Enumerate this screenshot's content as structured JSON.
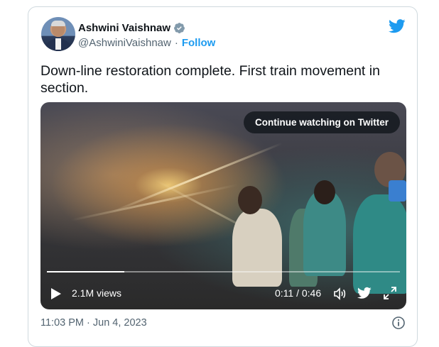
{
  "author": {
    "display_name": "Ashwini Vaishnaw",
    "handle": "@AshwiniVaishnaw",
    "separator": "·",
    "follow_label": "Follow",
    "verified_icon": "verified-badge-icon",
    "avatar": "profile-photo"
  },
  "brand": {
    "logo_icon": "twitter-bird-icon",
    "accent_color": "#1d9bf0"
  },
  "tweet": {
    "text": "Down-line restoration complete. First train movement in section."
  },
  "video": {
    "cta_label": "Continue watching on Twitter",
    "views": "2.1M views",
    "timecode": "0:11 / 0:46",
    "progress_fraction": 0.22,
    "controls": [
      "play-icon",
      "volume-icon",
      "twitter-bird-icon",
      "expand-icon"
    ]
  },
  "footer": {
    "timestamp": "11:03 PM · Jun 4, 2023",
    "info_icon": "info-icon"
  }
}
